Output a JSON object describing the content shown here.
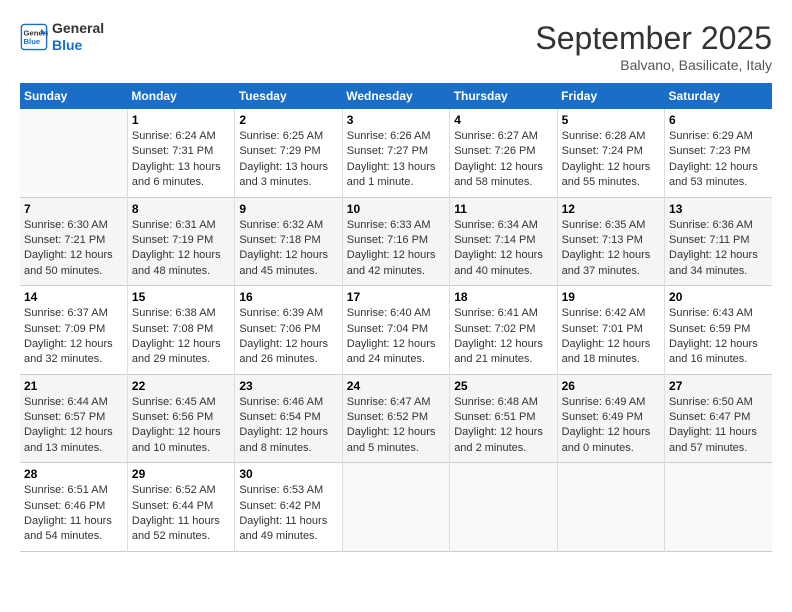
{
  "header": {
    "logo_line1": "General",
    "logo_line2": "Blue",
    "month": "September 2025",
    "location": "Balvano, Basilicate, Italy"
  },
  "days_of_week": [
    "Sunday",
    "Monday",
    "Tuesday",
    "Wednesday",
    "Thursday",
    "Friday",
    "Saturday"
  ],
  "weeks": [
    [
      {
        "day": "",
        "info": ""
      },
      {
        "day": "1",
        "info": "Sunrise: 6:24 AM\nSunset: 7:31 PM\nDaylight: 13 hours\nand 6 minutes."
      },
      {
        "day": "2",
        "info": "Sunrise: 6:25 AM\nSunset: 7:29 PM\nDaylight: 13 hours\nand 3 minutes."
      },
      {
        "day": "3",
        "info": "Sunrise: 6:26 AM\nSunset: 7:27 PM\nDaylight: 13 hours\nand 1 minute."
      },
      {
        "day": "4",
        "info": "Sunrise: 6:27 AM\nSunset: 7:26 PM\nDaylight: 12 hours\nand 58 minutes."
      },
      {
        "day": "5",
        "info": "Sunrise: 6:28 AM\nSunset: 7:24 PM\nDaylight: 12 hours\nand 55 minutes."
      },
      {
        "day": "6",
        "info": "Sunrise: 6:29 AM\nSunset: 7:23 PM\nDaylight: 12 hours\nand 53 minutes."
      }
    ],
    [
      {
        "day": "7",
        "info": "Sunrise: 6:30 AM\nSunset: 7:21 PM\nDaylight: 12 hours\nand 50 minutes."
      },
      {
        "day": "8",
        "info": "Sunrise: 6:31 AM\nSunset: 7:19 PM\nDaylight: 12 hours\nand 48 minutes."
      },
      {
        "day": "9",
        "info": "Sunrise: 6:32 AM\nSunset: 7:18 PM\nDaylight: 12 hours\nand 45 minutes."
      },
      {
        "day": "10",
        "info": "Sunrise: 6:33 AM\nSunset: 7:16 PM\nDaylight: 12 hours\nand 42 minutes."
      },
      {
        "day": "11",
        "info": "Sunrise: 6:34 AM\nSunset: 7:14 PM\nDaylight: 12 hours\nand 40 minutes."
      },
      {
        "day": "12",
        "info": "Sunrise: 6:35 AM\nSunset: 7:13 PM\nDaylight: 12 hours\nand 37 minutes."
      },
      {
        "day": "13",
        "info": "Sunrise: 6:36 AM\nSunset: 7:11 PM\nDaylight: 12 hours\nand 34 minutes."
      }
    ],
    [
      {
        "day": "14",
        "info": "Sunrise: 6:37 AM\nSunset: 7:09 PM\nDaylight: 12 hours\nand 32 minutes."
      },
      {
        "day": "15",
        "info": "Sunrise: 6:38 AM\nSunset: 7:08 PM\nDaylight: 12 hours\nand 29 minutes."
      },
      {
        "day": "16",
        "info": "Sunrise: 6:39 AM\nSunset: 7:06 PM\nDaylight: 12 hours\nand 26 minutes."
      },
      {
        "day": "17",
        "info": "Sunrise: 6:40 AM\nSunset: 7:04 PM\nDaylight: 12 hours\nand 24 minutes."
      },
      {
        "day": "18",
        "info": "Sunrise: 6:41 AM\nSunset: 7:02 PM\nDaylight: 12 hours\nand 21 minutes."
      },
      {
        "day": "19",
        "info": "Sunrise: 6:42 AM\nSunset: 7:01 PM\nDaylight: 12 hours\nand 18 minutes."
      },
      {
        "day": "20",
        "info": "Sunrise: 6:43 AM\nSunset: 6:59 PM\nDaylight: 12 hours\nand 16 minutes."
      }
    ],
    [
      {
        "day": "21",
        "info": "Sunrise: 6:44 AM\nSunset: 6:57 PM\nDaylight: 12 hours\nand 13 minutes."
      },
      {
        "day": "22",
        "info": "Sunrise: 6:45 AM\nSunset: 6:56 PM\nDaylight: 12 hours\nand 10 minutes."
      },
      {
        "day": "23",
        "info": "Sunrise: 6:46 AM\nSunset: 6:54 PM\nDaylight: 12 hours\nand 8 minutes."
      },
      {
        "day": "24",
        "info": "Sunrise: 6:47 AM\nSunset: 6:52 PM\nDaylight: 12 hours\nand 5 minutes."
      },
      {
        "day": "25",
        "info": "Sunrise: 6:48 AM\nSunset: 6:51 PM\nDaylight: 12 hours\nand 2 minutes."
      },
      {
        "day": "26",
        "info": "Sunrise: 6:49 AM\nSunset: 6:49 PM\nDaylight: 12 hours\nand 0 minutes."
      },
      {
        "day": "27",
        "info": "Sunrise: 6:50 AM\nSunset: 6:47 PM\nDaylight: 11 hours\nand 57 minutes."
      }
    ],
    [
      {
        "day": "28",
        "info": "Sunrise: 6:51 AM\nSunset: 6:46 PM\nDaylight: 11 hours\nand 54 minutes."
      },
      {
        "day": "29",
        "info": "Sunrise: 6:52 AM\nSunset: 6:44 PM\nDaylight: 11 hours\nand 52 minutes."
      },
      {
        "day": "30",
        "info": "Sunrise: 6:53 AM\nSunset: 6:42 PM\nDaylight: 11 hours\nand 49 minutes."
      },
      {
        "day": "",
        "info": ""
      },
      {
        "day": "",
        "info": ""
      },
      {
        "day": "",
        "info": ""
      },
      {
        "day": "",
        "info": ""
      }
    ]
  ]
}
